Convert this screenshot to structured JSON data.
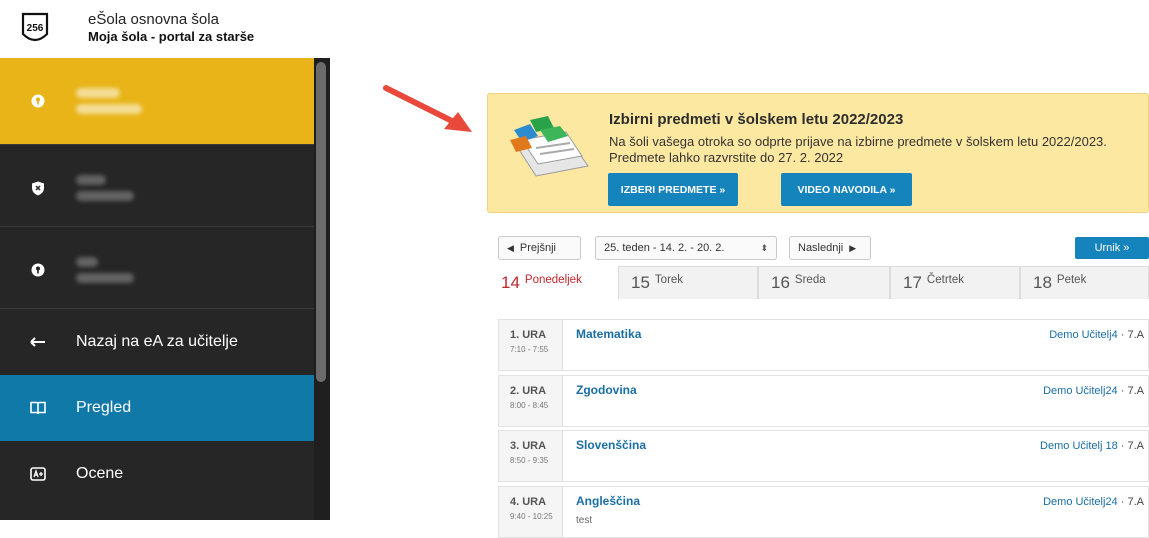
{
  "header": {
    "logo_text": "256",
    "school_name": "eŠola osnovna šola",
    "portal_name": "Moja šola - portal za starše"
  },
  "sidebar": {
    "children": [
      {
        "icon": "key-icon",
        "active": true
      },
      {
        "icon": "shield-icon",
        "active": false
      },
      {
        "icon": "key-icon",
        "active": false
      }
    ],
    "items": [
      {
        "label": "Nazaj na eA za učitelje",
        "icon": "arrow-left-icon"
      },
      {
        "label": "Pregled",
        "icon": "book-icon",
        "selected": true
      },
      {
        "label": "Ocene",
        "icon": "grades-icon"
      }
    ]
  },
  "banner": {
    "title": "Izbirni predmeti v šolskem letu 2022/2023",
    "text": "Na šoli vašega otroka so odprte prijave na izbirne predmete v šolskem letu 2022/2023. Predmete lahko razvrstite do 27. 2. 2022",
    "button_select": "IZBERI PREDMETE »",
    "button_video": "VIDEO NAVODILA »"
  },
  "toolbar": {
    "prev": "Prejšnji",
    "week": "25. teden - 14. 2. - 20. 2.",
    "next": "Naslednji",
    "schedule": "Urnik »"
  },
  "days": [
    {
      "num": "14",
      "name": "Ponedeljek",
      "active": true
    },
    {
      "num": "15",
      "name": "Torek"
    },
    {
      "num": "16",
      "name": "Sreda"
    },
    {
      "num": "17",
      "name": "Četrtek"
    },
    {
      "num": "18",
      "name": "Petek"
    }
  ],
  "lessons": [
    {
      "ura": "1. URA",
      "time": "7:10 - 7:55",
      "subject": "Matematika",
      "note": "",
      "teacher": "Demo Učitelj4",
      "class": "7.A"
    },
    {
      "ura": "2. URA",
      "time": "8:00 - 8:45",
      "subject": "Zgodovina",
      "note": "",
      "teacher": "Demo Učitelj24",
      "class": "7.A"
    },
    {
      "ura": "3. URA",
      "time": "8:50 - 9:35",
      "subject": "Slovenščina",
      "note": "",
      "teacher": "Demo Učitelj 18",
      "class": "7.A"
    },
    {
      "ura": "4. URA",
      "time": "9:40 - 10:25",
      "subject": "Angleščina",
      "note": "test",
      "teacher": "Demo Učitelj24",
      "class": "7.A"
    }
  ],
  "separator": "·",
  "colors": {
    "accent": "#1684bc",
    "active_child": "#e8b417",
    "sidebar": "#262626",
    "banner": "#fde8a2"
  }
}
